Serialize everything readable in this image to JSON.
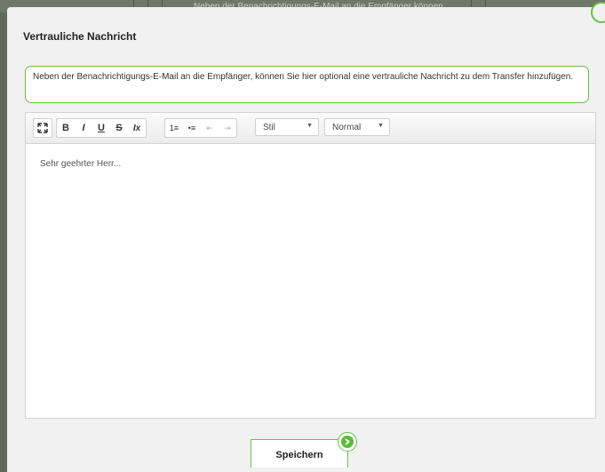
{
  "background": {
    "partial_text": "Neben der Benachrichtigungs-E-Mail an die Empfänger können"
  },
  "dialog": {
    "title": "Vertrauliche Nachricht",
    "info_text": "Neben der Benachrichtigungs-E-Mail an die Empfänger, können Sie hier optional eine vertrauliche Nachricht zu dem Transfer hinzufügen.",
    "save_label": "Speichern"
  },
  "toolbar": {
    "maximize": "⛶",
    "bold": "B",
    "italic": "I",
    "underline": "U",
    "strike": "S",
    "remove_format": "Ix",
    "numbered_list": "1≡",
    "bulleted_list": "•≡",
    "outdent": "⇤",
    "indent": "⇥",
    "style_value": "Stil",
    "format_value": "Normal"
  },
  "editor": {
    "content": "Sehr geehrter Herr..."
  },
  "colors": {
    "accent": "#6abf4b",
    "overlay": "#5f6b5a",
    "dialog_bg": "#f1f1f1"
  }
}
